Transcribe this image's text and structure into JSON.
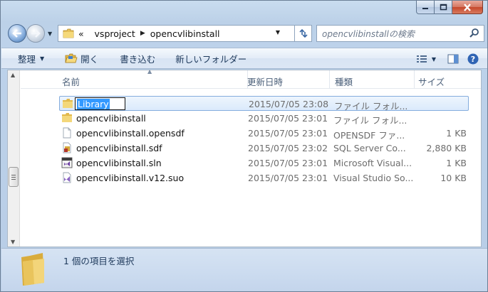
{
  "titlebar": {
    "minimize_icon": "minimize-icon",
    "maximize_icon": "maximize-icon",
    "close_icon": "close-icon"
  },
  "address": {
    "overflow": "«",
    "crumbs": [
      "vsproject",
      "opencvlibinstall"
    ]
  },
  "search": {
    "placeholder": "opencvlibinstallの検索"
  },
  "toolbar": {
    "organize": "整理",
    "open": "開く",
    "burn": "書き込む",
    "new_folder": "新しいフォルダー"
  },
  "columns": {
    "name": "名前",
    "date": "更新日時",
    "type": "種類",
    "size": "サイズ"
  },
  "files": [
    {
      "name": "Library",
      "date": "2015/07/05 23:08",
      "type": "ファイル フォル...",
      "size": "",
      "icon": "folder-icon"
    },
    {
      "name": "opencvlibinstall",
      "date": "2015/07/05 23:01",
      "type": "ファイル フォル...",
      "size": "",
      "icon": "folder-icon"
    },
    {
      "name": "opencvlibinstall.opensdf",
      "date": "2015/07/05 23:01",
      "type": "OPENSDF ファ...",
      "size": "1 KB",
      "icon": "file-icon"
    },
    {
      "name": "opencvlibinstall.sdf",
      "date": "2015/07/05 23:02",
      "type": "SQL Server Co...",
      "size": "2,880 KB",
      "icon": "sql-file-icon"
    },
    {
      "name": "opencvlibinstall.sln",
      "date": "2015/07/05 23:01",
      "type": "Microsoft Visual...",
      "size": "1 KB",
      "icon": "vs-solution-icon"
    },
    {
      "name": "opencvlibinstall.v12.suo",
      "date": "2015/07/05 23:01",
      "type": "Visual Studio So...",
      "size": "10 KB",
      "icon": "vs-suo-icon"
    }
  ],
  "status": {
    "text": "1 個の項目を選択"
  },
  "colors": {
    "accent": "#3399ff",
    "selection": "#dbeafc"
  }
}
